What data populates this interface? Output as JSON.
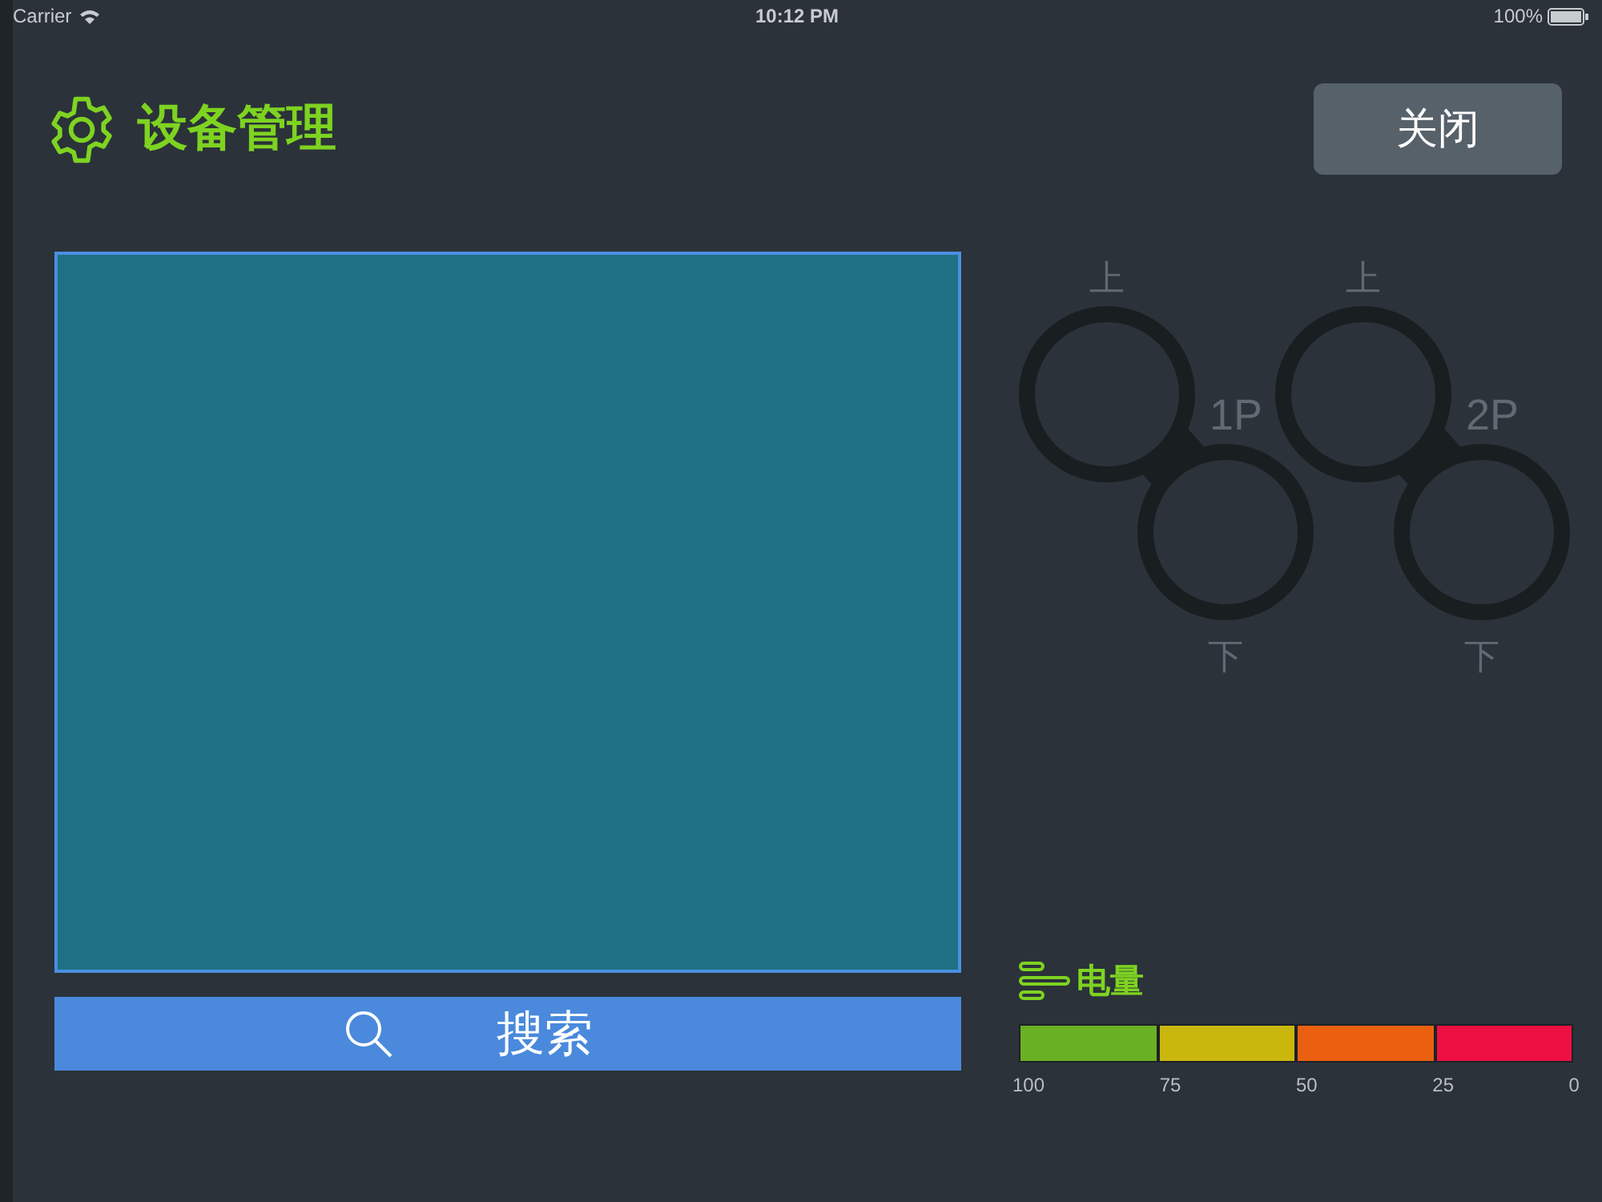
{
  "status_bar": {
    "carrier": "Carrier",
    "time": "10:12 PM",
    "battery": "100%"
  },
  "header": {
    "title": "设备管理",
    "close_button": "关闭"
  },
  "search_button": "搜索",
  "controllers": [
    {
      "top_label": "上",
      "player": "1P",
      "bottom_label": "下"
    },
    {
      "top_label": "上",
      "player": "2P",
      "bottom_label": "下"
    }
  ],
  "battery": {
    "title": "电量",
    "segments": [
      {
        "color": "#6ab023"
      },
      {
        "color": "#c9b70e"
      },
      {
        "color": "#eb6010"
      },
      {
        "color": "#ee1043"
      }
    ],
    "ticks": [
      "100",
      "75",
      "50",
      "25",
      "0"
    ]
  }
}
